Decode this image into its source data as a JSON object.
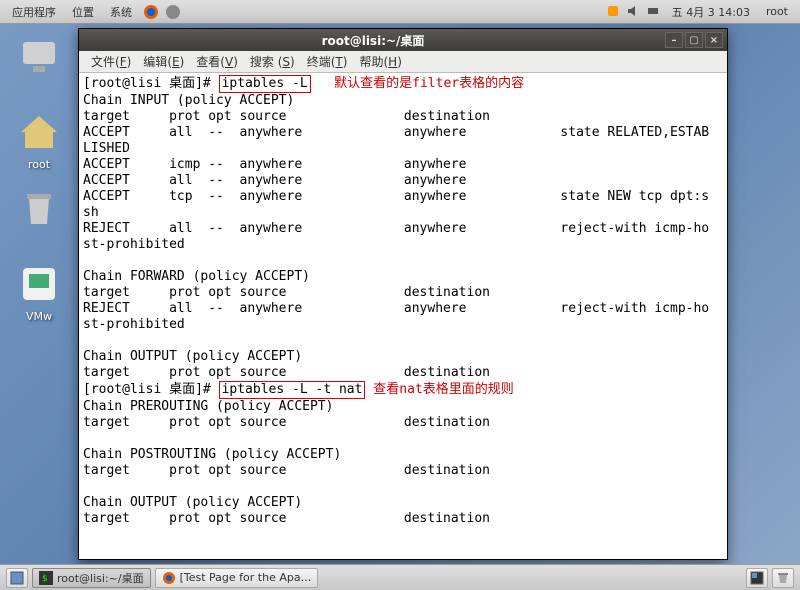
{
  "top_panel": {
    "menus": [
      "应用程序",
      "位置",
      "系统"
    ],
    "clock": "五 4月  3 14:03",
    "user": "root"
  },
  "desktop_icons": [
    {
      "label": ""
    },
    {
      "label": ""
    },
    {
      "label": "root  "
    },
    {
      "label": ""
    },
    {
      "label": "VMw"
    }
  ],
  "window": {
    "title": "root@lisi:~/桌面",
    "menus": [
      {
        "label": "文件",
        "accel": "F"
      },
      {
        "label": "编辑",
        "accel": "E"
      },
      {
        "label": "查看",
        "accel": "V"
      },
      {
        "label": "搜索",
        "accel": "S"
      },
      {
        "label": "终端",
        "accel": "T"
      },
      {
        "label": "帮助",
        "accel": "H"
      }
    ]
  },
  "terminal": {
    "prompt1": "[root@lisi 桌面]# ",
    "cmd1": "iptables -L",
    "annot1": "   默认查看的是filter表格的内容",
    "body1": [
      "Chain INPUT (policy ACCEPT)",
      "target     prot opt source               destination",
      "ACCEPT     all  --  anywhere             anywhere            state RELATED,ESTAB",
      "LISHED",
      "ACCEPT     icmp --  anywhere             anywhere",
      "ACCEPT     all  --  anywhere             anywhere",
      "ACCEPT     tcp  --  anywhere             anywhere            state NEW tcp dpt:s",
      "sh",
      "REJECT     all  --  anywhere             anywhere            reject-with icmp-ho",
      "st-prohibited",
      "",
      "Chain FORWARD (policy ACCEPT)",
      "target     prot opt source               destination",
      "REJECT     all  --  anywhere             anywhere            reject-with icmp-ho",
      "st-prohibited",
      "",
      "Chain OUTPUT (policy ACCEPT)",
      "target     prot opt source               destination"
    ],
    "prompt2": "[root@lisi 桌面]# ",
    "cmd2": "iptables -L -t nat",
    "annot2_pre": " 查看",
    "annot2_nat": "nat",
    "annot2_post": "表格里面的规则",
    "body2": [
      "Chain PREROUTING (policy ACCEPT)",
      "target     prot opt source               destination",
      "",
      "Chain POSTROUTING (policy ACCEPT)",
      "target     prot opt source               destination",
      "",
      "Chain OUTPUT (policy ACCEPT)",
      "target     prot opt source               destination"
    ]
  },
  "taskbar": {
    "tasks": [
      {
        "label": "root@lisi:~/桌面",
        "active": true
      },
      {
        "label": "[Test Page for the Apa...",
        "active": false
      }
    ]
  }
}
